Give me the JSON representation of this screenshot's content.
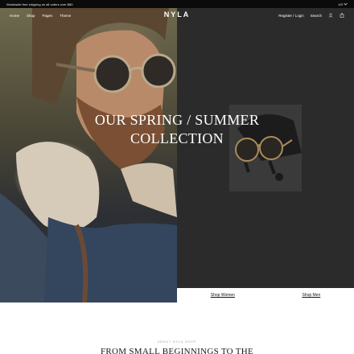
{
  "announcement": {
    "text": "Worldwide free shipping on all orders over $80",
    "locale": "US"
  },
  "nav": {
    "brand": "NYLA",
    "links": [
      {
        "label": "Home"
      },
      {
        "label": "Shop"
      },
      {
        "label": "Pages"
      },
      {
        "label": "Theme"
      }
    ],
    "account": "Register / Login",
    "search": "Search",
    "icons": [
      "chevron-down-icon",
      "user-icon",
      "bag-icon"
    ]
  },
  "hero": {
    "title_line1": "OUR SPRING / SUMMER",
    "title_line2": "COLLECTION",
    "shop_women": "Shop Women",
    "shop_men": "Shop Men",
    "colors": {
      "right_panel": "#2b2b2b",
      "product_bg": "#3c3c3c"
    }
  },
  "about": {
    "eyebrow": "ABOUT NYLA SHOP",
    "heading": "FROM SMALL BEGINNINGS TO THE"
  }
}
